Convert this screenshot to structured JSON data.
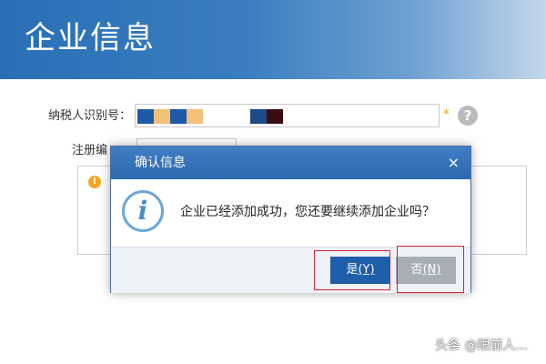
{
  "header": {
    "title": "企业信息"
  },
  "form": {
    "tax_id_label": "纳税人识别号：",
    "registration_label": "注册编",
    "required_mark": "*",
    "help_icon_glyph": "?",
    "warn_icon_glyph": "!"
  },
  "dialog": {
    "title": "确认信息",
    "close_glyph": "×",
    "info_icon_glyph": "i",
    "message": "企业已经添加成功，您还要继续添加企业吗？",
    "yes_button": {
      "label": "是",
      "hotkey": "(Y)"
    },
    "no_button": {
      "label": "否",
      "hotkey": "(N)"
    }
  },
  "watermark": "头条 @眼前人...",
  "colors": {
    "header_blue": "#2a6fb5",
    "dialog_titlebar": "#3f7fc4",
    "primary_button": "#1e5eaa",
    "disabled_button": "#a8aeb6",
    "highlight_red": "#d9262c",
    "warning_orange": "#f5a623"
  },
  "icons": [
    "help-icon",
    "warning-icon",
    "info-icon",
    "close-icon"
  ]
}
